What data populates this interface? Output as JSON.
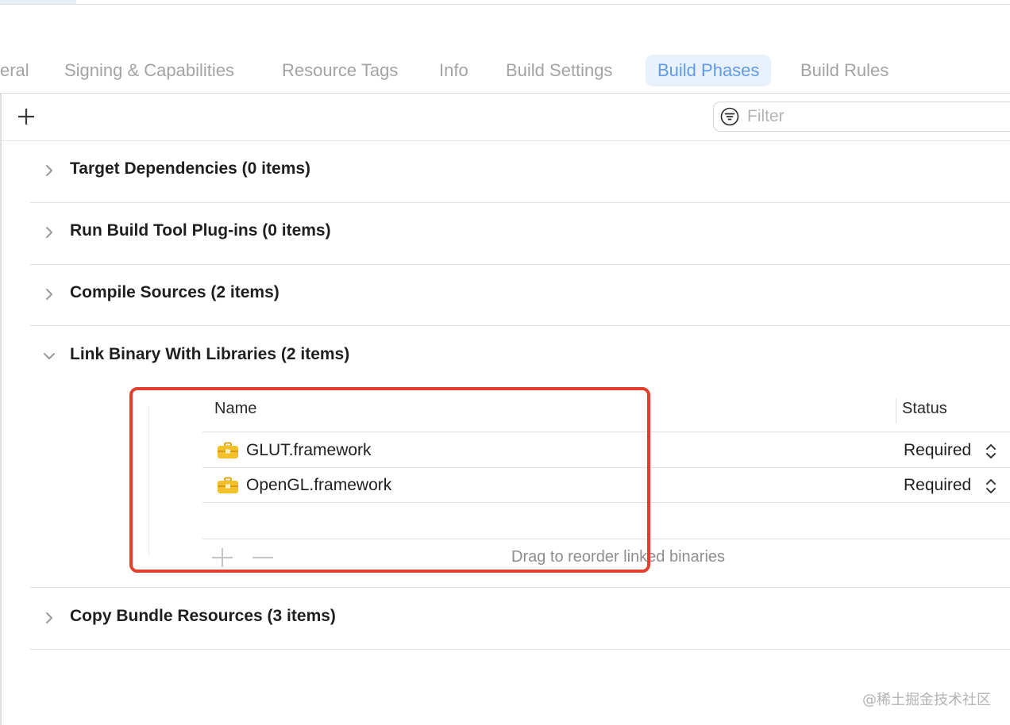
{
  "tabs": [
    {
      "label": "eral",
      "active": false
    },
    {
      "label": "Signing & Capabilities",
      "active": false
    },
    {
      "label": "Resource Tags",
      "active": false
    },
    {
      "label": "Info",
      "active": false
    },
    {
      "label": "Build Settings",
      "active": false
    },
    {
      "label": "Build Phases",
      "active": true
    },
    {
      "label": "Build Rules",
      "active": false
    }
  ],
  "toolbar": {
    "add_icon": "plus-icon",
    "filter_icon": "filter-icon",
    "filter_placeholder": "Filter",
    "filter_value": ""
  },
  "phases": [
    {
      "title": "Target Dependencies (0 items)",
      "expanded": false
    },
    {
      "title": "Run Build Tool Plug-ins (0 items)",
      "expanded": false
    },
    {
      "title": "Compile Sources (2 items)",
      "expanded": false
    },
    {
      "title": "Link Binary With Libraries (2 items)",
      "expanded": true
    },
    {
      "title": "Copy Bundle Resources (3 items)",
      "expanded": false
    }
  ],
  "libraries": {
    "columns": {
      "name": "Name",
      "status": "Status"
    },
    "rows": [
      {
        "name": "GLUT.framework",
        "status": "Required",
        "icon": "framework-toolbox-icon"
      },
      {
        "name": "OpenGL.framework",
        "status": "Required",
        "icon": "framework-toolbox-icon"
      }
    ],
    "hint": "Drag to reorder linked binaries"
  },
  "colors": {
    "accent": "#5f9be6",
    "accent_bg": "#e9f1fc",
    "highlight_border": "#e0402c",
    "framework_icon": "#f4c02a"
  },
  "watermark": "@稀土掘金技术社区"
}
